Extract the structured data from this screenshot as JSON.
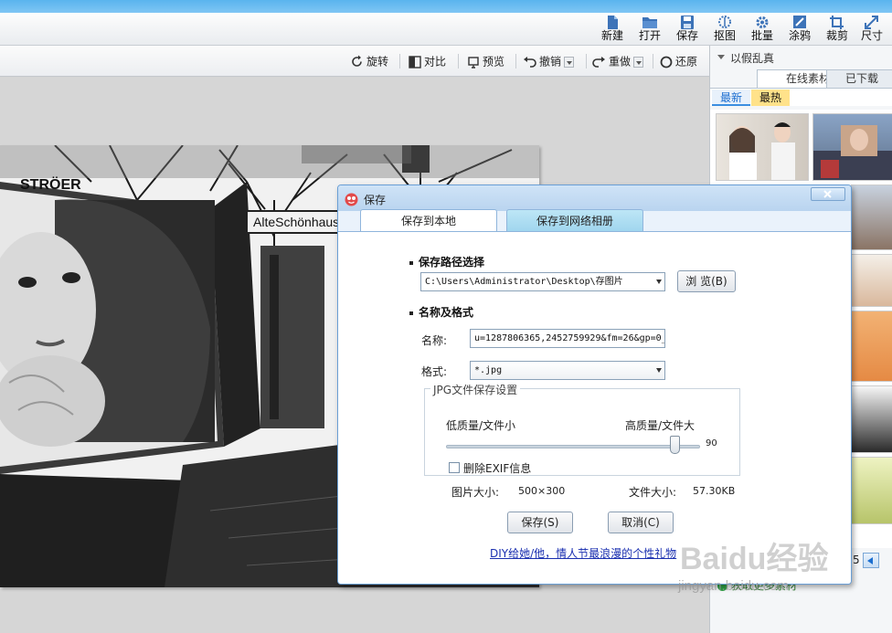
{
  "main_toolbar": {
    "new": "新建",
    "open": "打开",
    "save": "保存",
    "cutout": "抠图",
    "batch": "批量",
    "doodle": "涂鸦",
    "crop": "裁剪",
    "size": "尺寸"
  },
  "edit_toolbar": {
    "rotate": "旋转",
    "compare": "对比",
    "preview": "预览",
    "undo": "撤销",
    "redo": "重做",
    "restore": "还原"
  },
  "canvas": {
    "sign_brand": "STRÖER",
    "sign_street": "AlteSchönhause"
  },
  "right_panel": {
    "header": "以假乱真",
    "tab_online": "在线素材",
    "tab_downloaded": "已下载",
    "subtab_newest": "最新",
    "subtab_hottest": "最热",
    "page_number": "5",
    "footer_fragment": "获取更多素材"
  },
  "dialog": {
    "title": "保存",
    "tab_local": "保存到本地",
    "tab_online": "保存到网络相册",
    "section_path": "保存路径选择",
    "path_value": "C:\\Users\\Administrator\\Desktop\\存图片",
    "browse_label": "浏 览(B)",
    "section_name_format": "名称及格式",
    "name_label": "名称:",
    "name_value": "u=1287806365,2452759929&fm=26&gp=0_",
    "format_label": "格式:",
    "format_value": "*.jpg",
    "jpg_group_title": "JPG文件保存设置",
    "quality_low": "低质量/文件小",
    "quality_high": "高质量/文件大",
    "quality_value": "90",
    "quality_fraction": 0.9,
    "remove_exif": "删除EXIF信息",
    "image_size_label": "图片大小:",
    "image_size_value": "500×300",
    "file_size_label": "文件大小:",
    "file_size_value": "57.30KB",
    "save_button": "保存(S)",
    "cancel_button": "取消(C)",
    "promo_link": "DIY给她/他，情人节最浪漫的个性礼物"
  },
  "watermark": {
    "text": "Baidu经验",
    "url": "jingyan.baidu.com"
  },
  "colors": {
    "title_strip": "#5ab4ee",
    "dialog_border": "#6a9fd6",
    "dialog_bg": "#eaf2fb",
    "link": "#1a2fb0",
    "hot_tab": "#ffe28a"
  }
}
